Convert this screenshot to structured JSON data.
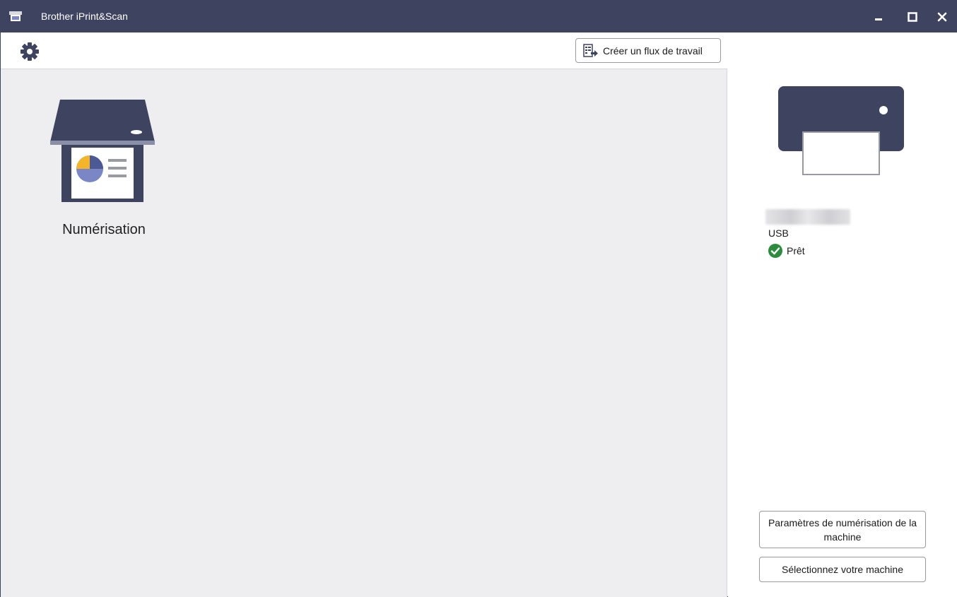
{
  "window": {
    "title": "Brother iPrint&Scan",
    "colors": {
      "titlebar": "#3e4360",
      "main_bg": "#eeedf0",
      "accent_yellow": "#f5b52a",
      "accent_blue": "#7a86c6",
      "status_green": "#2e8b3e"
    }
  },
  "toolbar": {
    "settings_icon": "gear-icon",
    "workflow_button_label": "Créer un flux de travail"
  },
  "main": {
    "tiles": [
      {
        "label": "Numérisation",
        "icon": "scanner-icon"
      }
    ]
  },
  "device": {
    "connection": "USB",
    "status": "Prêt",
    "status_icon": "check-circle-icon"
  },
  "side_buttons": {
    "scan_settings_label": "Paramètres de numérisation de la machine",
    "select_machine_label": "Sélectionnez votre machine"
  }
}
